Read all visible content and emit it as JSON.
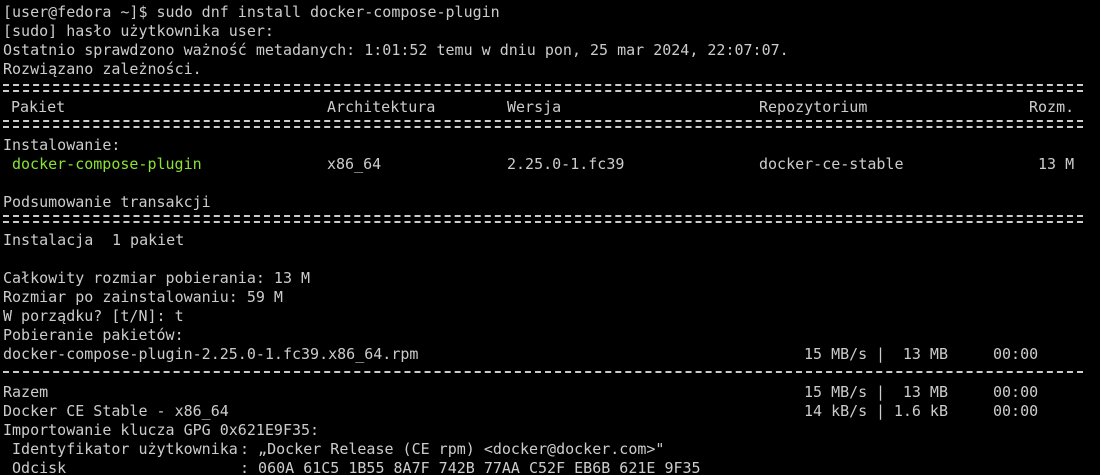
{
  "prompt": {
    "text": "[user@fedora ~]$ sudo dnf install docker-compose-plugin"
  },
  "lines": {
    "sudo_password": "[sudo] hasło użytkownika user:",
    "metadata_check": "Ostatnio sprawdzono ważność metadanych: 1:01:52 temu w dniu pon, 25 mar 2024, 22:07:07.",
    "deps_resolved": "Rozwiązano zależności."
  },
  "table": {
    "headers": {
      "package": "Pakiet",
      "arch": "Architektura",
      "version": "Wersja",
      "repo": "Repozytorium",
      "size": "Rozm."
    },
    "section_installing": "Instalowanie:",
    "rows": [
      {
        "package": "docker-compose-plugin",
        "arch": "x86_64",
        "version": "2.25.0-1.fc39",
        "repo": "docker-ce-stable",
        "size": "13 M"
      }
    ]
  },
  "summary": {
    "title": "Podsumowanie transakcji",
    "install_label": "Instalacja",
    "install_count": "1 pakiet",
    "total_download": "Całkowity rozmiar pobierania: 13 M",
    "installed_size": "Rozmiar po zainstalowaniu: 59 M",
    "confirm_prompt": "W porządku? [t/N]: t",
    "downloading": "Pobieranie pakietów:"
  },
  "downloads": [
    {
      "name": "docker-compose-plugin-2.25.0-1.fc39.x86_64.rpm",
      "speed": "15 MB/s",
      "size": "13 MB",
      "time": "00:00"
    }
  ],
  "totals": [
    {
      "name": "Razem",
      "speed": "15 MB/s",
      "size": "13 MB",
      "time": "00:00"
    },
    {
      "name": "Docker CE Stable - x86_64",
      "speed": "14 kB/s",
      "size": "1.6 kB",
      "time": "00:00"
    }
  ],
  "gpg": {
    "importing": "Importowanie klucza GPG 0x621E9F35:",
    "user_id_label": " Identyfikator użytkownika",
    "user_id_value": ": „Docker Release (CE rpm) <docker@docker.com>\"",
    "fingerprint_label": " Odcisk",
    "fingerprint_value": ": 060A 61C5 1B55 8A7F 742B 77AA C52F EB6B 621E 9F35"
  },
  "colors": {
    "background": "#000000",
    "foreground": "#cccccc",
    "package_highlight": "#8ae234"
  }
}
